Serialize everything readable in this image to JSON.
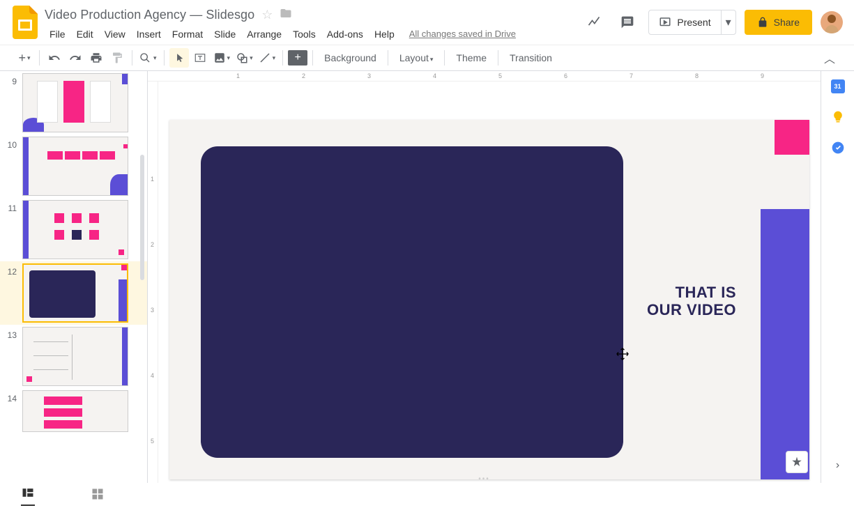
{
  "header": {
    "doc_title": "Video Production Agency — Slidesgo",
    "save_status": "All changes saved in Drive",
    "present_label": "Present",
    "share_label": "Share"
  },
  "menus": [
    "File",
    "Edit",
    "View",
    "Insert",
    "Format",
    "Slide",
    "Arrange",
    "Tools",
    "Add-ons",
    "Help"
  ],
  "toolbar": {
    "background": "Background",
    "layout": "Layout",
    "theme": "Theme",
    "transition": "Transition"
  },
  "filmstrip": {
    "slides": [
      {
        "number": "9"
      },
      {
        "number": "10"
      },
      {
        "number": "11"
      },
      {
        "number": "12",
        "selected": true
      },
      {
        "number": "13"
      },
      {
        "number": "14"
      }
    ]
  },
  "canvas": {
    "text_line1": "THAT IS",
    "text_line2": "OUR VIDEO"
  },
  "ruler_h": [
    "1",
    "2",
    "3",
    "4",
    "5",
    "6",
    "7",
    "8",
    "9"
  ],
  "ruler_v": [
    "1",
    "2",
    "3",
    "4",
    "5"
  ]
}
